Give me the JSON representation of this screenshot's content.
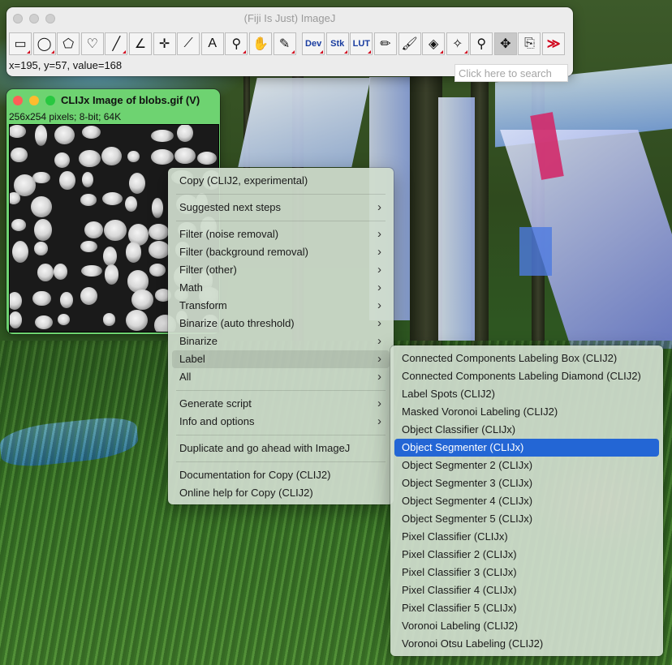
{
  "toolbar_window": {
    "title": "(Fiji Is Just) ImageJ",
    "status": "x=195, y=57, value=168",
    "search_placeholder": "Click here to search",
    "tools": [
      {
        "name": "rectangle-tool-icon",
        "glyph": "▭"
      },
      {
        "name": "oval-tool-icon",
        "glyph": "◯"
      },
      {
        "name": "polygon-tool-icon",
        "glyph": "⬠"
      },
      {
        "name": "freehand-tool-icon",
        "glyph": "♡"
      },
      {
        "name": "line-tool-icon",
        "glyph": "╱"
      },
      {
        "name": "angle-tool-icon",
        "glyph": "∠"
      },
      {
        "name": "point-tool-icon",
        "glyph": "✛"
      },
      {
        "name": "wand-tool-icon",
        "glyph": "⟋"
      },
      {
        "name": "text-tool-icon",
        "glyph": "A"
      },
      {
        "name": "magnifier-tool-icon",
        "glyph": "⚲"
      },
      {
        "name": "hand-tool-icon",
        "glyph": "✋"
      },
      {
        "name": "color-picker-tool-icon",
        "glyph": "✎"
      },
      {
        "name": "dev-menu-button",
        "text": "Dev"
      },
      {
        "name": "stk-menu-button",
        "text": "Stk"
      },
      {
        "name": "lut-menu-button",
        "text": "LUT"
      },
      {
        "name": "pencil-tool-icon",
        "glyph": "✏"
      },
      {
        "name": "paintbrush-tool-icon",
        "glyph": "🖌"
      },
      {
        "name": "flood-fill-tool-icon",
        "glyph": "◈"
      },
      {
        "name": "sparkle-tool-icon",
        "glyph": "✧"
      },
      {
        "name": "search-tool-icon",
        "glyph": "⚲"
      },
      {
        "name": "move-tool-icon",
        "glyph": "✥"
      },
      {
        "name": "clipboard-tool-icon",
        "glyph": "⎘"
      },
      {
        "name": "more-tools-icon",
        "glyph": "≫"
      }
    ]
  },
  "image_window": {
    "title": "CLIJx Image of blobs.gif (V)",
    "info": "256x254 pixels; 8-bit; 64K"
  },
  "context_menu": {
    "items": [
      {
        "label": "Copy (CLIJ2, experimental)",
        "submenu": false
      },
      {
        "separator": true
      },
      {
        "label": "Suggested next steps",
        "submenu": true
      },
      {
        "separator": true
      },
      {
        "label": "Filter (noise removal)",
        "submenu": true
      },
      {
        "label": "Filter (background removal)",
        "submenu": true
      },
      {
        "label": "Filter (other)",
        "submenu": true
      },
      {
        "label": "Math",
        "submenu": true
      },
      {
        "label": "Transform",
        "submenu": true
      },
      {
        "label": "Binarize (auto threshold)",
        "submenu": true
      },
      {
        "label": "Binarize",
        "submenu": true
      },
      {
        "label": "Label",
        "submenu": true,
        "hover": true
      },
      {
        "label": "All",
        "submenu": true
      },
      {
        "separator": true
      },
      {
        "label": "Generate script",
        "submenu": true
      },
      {
        "label": "Info and options",
        "submenu": true
      },
      {
        "separator": true
      },
      {
        "label": "Duplicate and go ahead with ImageJ",
        "submenu": false
      },
      {
        "separator": true
      },
      {
        "label": "Documentation for Copy (CLIJ2)",
        "submenu": false
      },
      {
        "label": "Online help for Copy (CLIJ2)",
        "submenu": false
      }
    ]
  },
  "label_submenu": {
    "items": [
      {
        "label": "Connected Components Labeling Box (CLIJ2)"
      },
      {
        "label": "Connected Components Labeling Diamond (CLIJ2)"
      },
      {
        "label": "Label Spots (CLIJ2)"
      },
      {
        "label": "Masked Voronoi Labeling (CLIJ2)"
      },
      {
        "label": "Object Classifier (CLIJx)"
      },
      {
        "label": "Object Segmenter (CLIJx)",
        "selected": true
      },
      {
        "label": "Object Segmenter 2 (CLIJx)"
      },
      {
        "label": "Object Segmenter 3 (CLIJx)"
      },
      {
        "label": "Object Segmenter 4 (CLIJx)"
      },
      {
        "label": "Object Segmenter 5 (CLIJx)"
      },
      {
        "label": "Pixel Classifier (CLIJx)"
      },
      {
        "label": "Pixel Classifier 2 (CLIJx)"
      },
      {
        "label": "Pixel Classifier 3 (CLIJx)"
      },
      {
        "label": "Pixel Classifier 4 (CLIJx)"
      },
      {
        "label": "Pixel Classifier 5 (CLIJx)"
      },
      {
        "label": "Voronoi Labeling (CLIJ2)"
      },
      {
        "label": "Voronoi Otsu Labeling (CLIJ2)"
      }
    ]
  },
  "colors": {
    "selection": "#2366d5",
    "image_window_frame": "#6ed371",
    "close_light": "#ff5f57",
    "minimize_light": "#febc2e",
    "zoom_light": "#28c840"
  }
}
